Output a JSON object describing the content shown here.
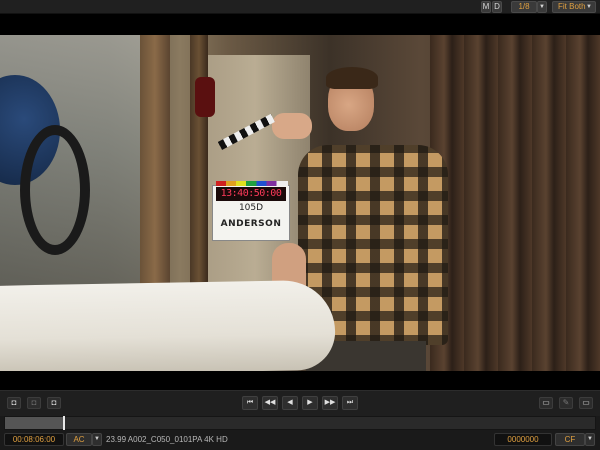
{
  "topbar": {
    "m_label": "M",
    "d_label": "D",
    "page_indicator": "1/8",
    "fit_label": "Fit Both"
  },
  "clapper": {
    "timecode": "13:40:50:00",
    "line1": "105D",
    "line2": "ANDERSON"
  },
  "transport": {
    "left_icons": [
      "camera-icon",
      "camera-dim-icon",
      "camera-3d-icon"
    ],
    "controls": [
      "skip-start-icon",
      "rewind-icon",
      "step-back-icon",
      "play-icon",
      "step-forward-icon",
      "skip-end-icon"
    ],
    "right_icons": [
      "monitor-icon",
      "pencil-icon",
      "screen-icon"
    ]
  },
  "scrub": {
    "progress": 0.1
  },
  "status": {
    "timecode": "00:08:06:00",
    "mode": "AC",
    "clip_info": "23.99  A002_C050_0101PA  4K HD",
    "frame_counter": "0000000",
    "right_mode": "CF"
  },
  "colors": {
    "accent": "#e0a040",
    "timecode_red": "#ff3a5a"
  }
}
